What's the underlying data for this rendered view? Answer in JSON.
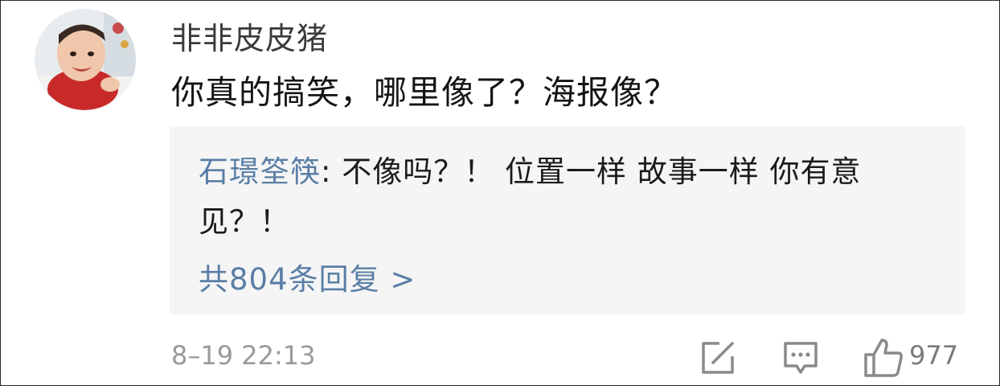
{
  "comment": {
    "username": "非非皮皮猪",
    "text": "你真的搞笑，哪里像了？海报像？",
    "timestamp": "8–19 22:13",
    "like_count": "977"
  },
  "reply": {
    "author": "石璟筌筷",
    "separator": ": ",
    "text": "不像吗？！ 位置一样 故事一样 你有意见？！",
    "more_label": "共804条回复 >"
  },
  "icons": {
    "share": "edit-share-icon",
    "reply": "comment-bubble-icon",
    "like": "thumbs-up-icon"
  },
  "colors": {
    "link": "#5a7ea6",
    "reply_background": "#f5f5f5",
    "meta_text": "#9a9a9a"
  }
}
